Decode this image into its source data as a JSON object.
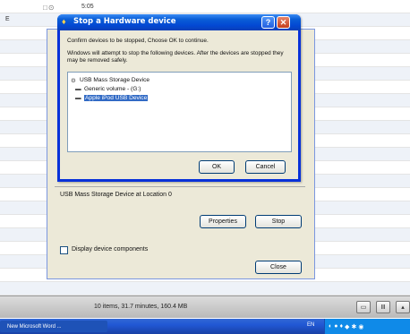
{
  "background": {
    "left_text": "E",
    "icons": "□⊙",
    "time": "5:05"
  },
  "parent_dialog": {
    "device_location": "USB Mass Storage Device at Location 0",
    "properties_button": "Properties",
    "stop_button": "Stop",
    "display_components_label": "Display device components",
    "display_components_checked": false,
    "close_button": "Close"
  },
  "dialog": {
    "title": "Stop a Hardware device",
    "help_glyph": "?",
    "close_glyph": "✕",
    "confirm_text": "Confirm devices to be stopped, Choose OK to continue.",
    "warning_text": "Windows will attempt to stop the following devices. After the devices are stopped they may be removed safely.",
    "devices": [
      {
        "label": "USB Mass Storage Device",
        "icon": "usb-device-icon",
        "selected": false
      },
      {
        "label": "Generic volume - (G:)",
        "icon": "drive-icon",
        "selected": false
      },
      {
        "label": "Apple iPod USB Device",
        "icon": "drive-icon",
        "selected": true
      }
    ],
    "ok_button": "OK",
    "cancel_button": "Cancel"
  },
  "status_bar": {
    "summary": "10 items, 31.7 minutes, 160.4 MB"
  },
  "taskbar": {
    "task_item": "New Microsoft Word ...",
    "language": "EN"
  }
}
